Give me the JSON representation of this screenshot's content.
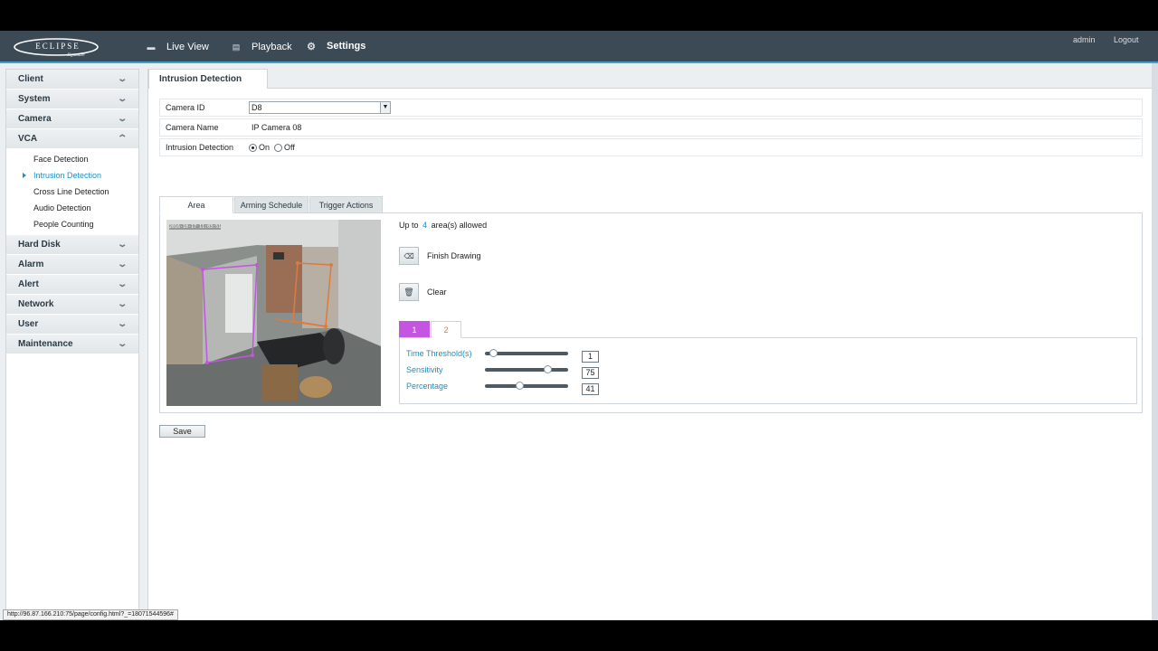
{
  "header": {
    "nav": [
      {
        "label": "Live View",
        "icon": "monitor-icon"
      },
      {
        "label": "Playback",
        "icon": "film-icon"
      },
      {
        "label": "Settings",
        "icon": "gear-icon",
        "active": true
      }
    ],
    "user": "admin",
    "logout": "Logout",
    "accent_color": "#3aa3c8"
  },
  "sidebar": {
    "sections": [
      {
        "label": "Client"
      },
      {
        "label": "System"
      },
      {
        "label": "Camera"
      },
      {
        "label": "VCA",
        "expanded": true,
        "items": [
          "Face Detection",
          "Intrusion Detection",
          "Cross Line Detection",
          "Audio Detection",
          "People Counting"
        ],
        "active_item": "Intrusion Detection"
      },
      {
        "label": "Hard Disk"
      },
      {
        "label": "Alarm"
      },
      {
        "label": "Alert"
      },
      {
        "label": "Network"
      },
      {
        "label": "User"
      },
      {
        "label": "Maintenance"
      }
    ]
  },
  "page": {
    "tab": "Intrusion Detection",
    "camera_id_label": "Camera ID",
    "camera_id_value": "D8",
    "camera_name_label": "Camera Name",
    "camera_name_value": "IP Camera 08",
    "intrusion_label": "Intrusion Detection",
    "on_label": "On",
    "off_label": "Off",
    "intrusion_selected": "On",
    "subtabs": [
      "Area",
      "Arming Schedule",
      "Trigger Actions"
    ],
    "active_subtab": "Area",
    "video_timestamp": "2016-10-17 11:03:51",
    "areas_prefix": "Up to",
    "areas_count": "4",
    "areas_suffix": "area(s) allowed",
    "finish_drawing": "Finish Drawing",
    "clear": "Clear",
    "area_tabs": [
      "1",
      "2"
    ],
    "area_colors": {
      "1": "#c455e0",
      "2": "#e07a3c"
    },
    "sliders": [
      {
        "label": "Time Threshold(s)",
        "value": 1,
        "min": 0,
        "max": 10
      },
      {
        "label": "Sensitivity",
        "value": 75,
        "min": 0,
        "max": 100
      },
      {
        "label": "Percentage",
        "value": 41,
        "min": 0,
        "max": 100
      }
    ],
    "save": "Save"
  },
  "status_url": "http://96.87.166.210:75/page/config.html?_=18071544596#"
}
